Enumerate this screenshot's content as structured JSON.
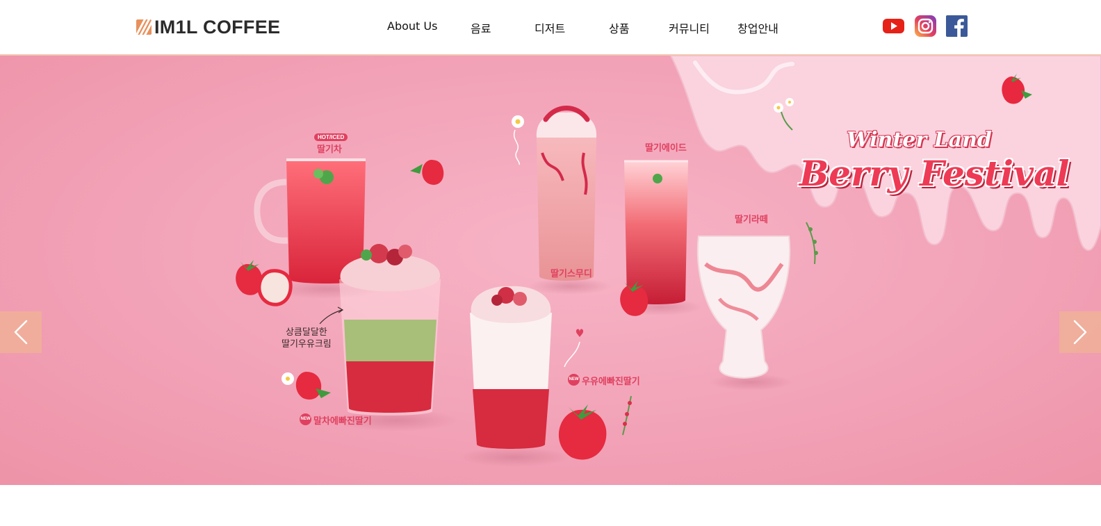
{
  "header": {
    "logo_text": "IM1L COFFEE",
    "nav": [
      {
        "label": "About Us"
      },
      {
        "label": "음료"
      },
      {
        "label": "디저트"
      },
      {
        "label": "상품"
      },
      {
        "label": "커뮤니티"
      },
      {
        "label": "창업안내"
      }
    ],
    "social": [
      {
        "icon": "youtube-icon",
        "color": "#e62117"
      },
      {
        "icon": "instagram-icon",
        "color": "#c1358a"
      },
      {
        "icon": "facebook-icon",
        "color": "#3b5998"
      }
    ]
  },
  "hero": {
    "title_line1": "Winter Land",
    "title_line2": "Berry Festival",
    "badge_hot": "HOT/ICED",
    "badge_new": "NEW",
    "products": [
      {
        "name": "딸기차"
      },
      {
        "name": "딸기스무디"
      },
      {
        "name": "딸기에이드"
      },
      {
        "name": "딸기라떼"
      },
      {
        "name": "우유에빠진딸기"
      },
      {
        "name": "말차에빠진딸기"
      }
    ],
    "handwritten": [
      "상큼달달한",
      "딸기우유크림"
    ],
    "prev_icon": "chevron-left-icon",
    "next_icon": "chevron-right-icon",
    "colors": {
      "accent": "#e0405f",
      "arrow_bg": "#f0b296"
    }
  }
}
